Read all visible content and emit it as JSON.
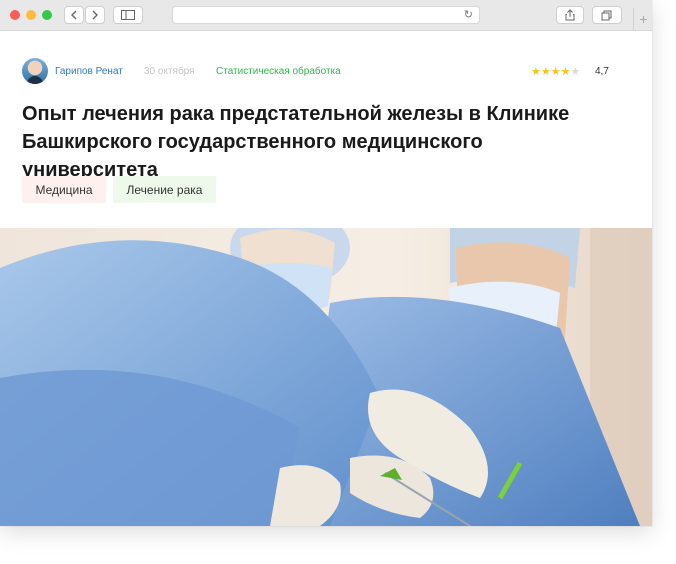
{
  "article": {
    "author": "Гарипов Ренат",
    "date": "30 октября",
    "category": "Статистическая обработка",
    "rating": "4,7",
    "rating_value": 4.7,
    "rating_max": 5,
    "title": "Опыт лечения рака предстательной железы в Клинике Башкирского государственного медицинского университета",
    "tags": [
      "Медицина",
      "Лечение рака"
    ]
  },
  "colors": {
    "author": "#2f7ac0",
    "category": "#2db84a",
    "star": "#f5c518",
    "tag_medicine_bg": "#fdf0ee",
    "tag_cancer_bg": "#eef9ec"
  },
  "icons": {
    "back": "chevron-left-icon",
    "forward": "chevron-right-icon",
    "sidebar": "sidebar-icon",
    "reload": "reload-icon",
    "share": "share-icon",
    "tabs": "tabs-icon",
    "new_tab": "plus-icon"
  }
}
